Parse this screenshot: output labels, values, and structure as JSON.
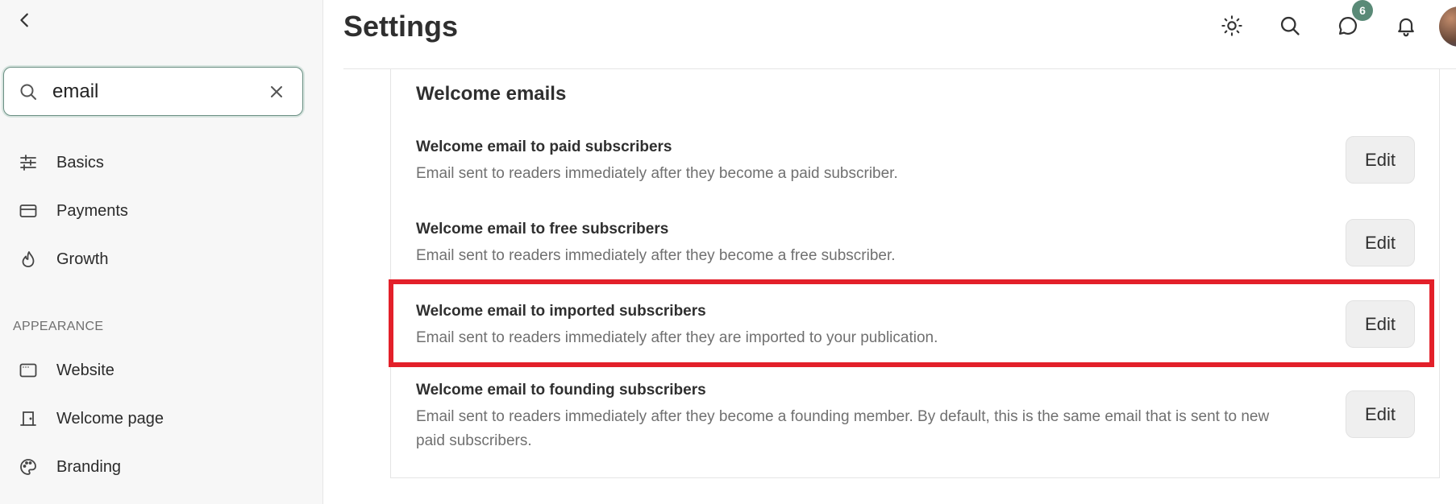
{
  "sidebar": {
    "search": {
      "value": "email",
      "placeholder": ""
    },
    "items": [
      {
        "label": "Basics",
        "icon": "sliders-icon"
      },
      {
        "label": "Payments",
        "icon": "credit-card-icon"
      },
      {
        "label": "Growth",
        "icon": "flame-icon"
      }
    ],
    "section_label": "APPEARANCE",
    "appearance_items": [
      {
        "label": "Website",
        "icon": "browser-window-icon"
      },
      {
        "label": "Welcome page",
        "icon": "door-icon"
      },
      {
        "label": "Branding",
        "icon": "palette-icon"
      }
    ]
  },
  "header": {
    "title": "Settings",
    "icons": [
      "sun-icon",
      "search-icon",
      "chat-bubble-icon",
      "bell-icon"
    ],
    "notification_count": "6"
  },
  "main": {
    "section_title": "Welcome emails",
    "rows": [
      {
        "title": "Welcome email to paid subscribers",
        "description": "Email sent to readers immediately after they become a paid subscriber.",
        "button": "Edit"
      },
      {
        "title": "Welcome email to free subscribers",
        "description": "Email sent to readers immediately after they become a free subscriber.",
        "button": "Edit"
      },
      {
        "title": "Welcome email to imported subscribers",
        "description": "Email sent to readers immediately after they are imported to your publication.",
        "button": "Edit"
      },
      {
        "title": "Welcome email to founding subscribers",
        "description": "Email sent to readers immediately after they become a founding member. By default, this is the same email that is sent to new paid subscribers.",
        "button": "Edit"
      }
    ]
  },
  "colors": {
    "highlight": "#e3202a",
    "accent": "#5a8a77",
    "sidebar_bg": "#f7f7f7"
  }
}
